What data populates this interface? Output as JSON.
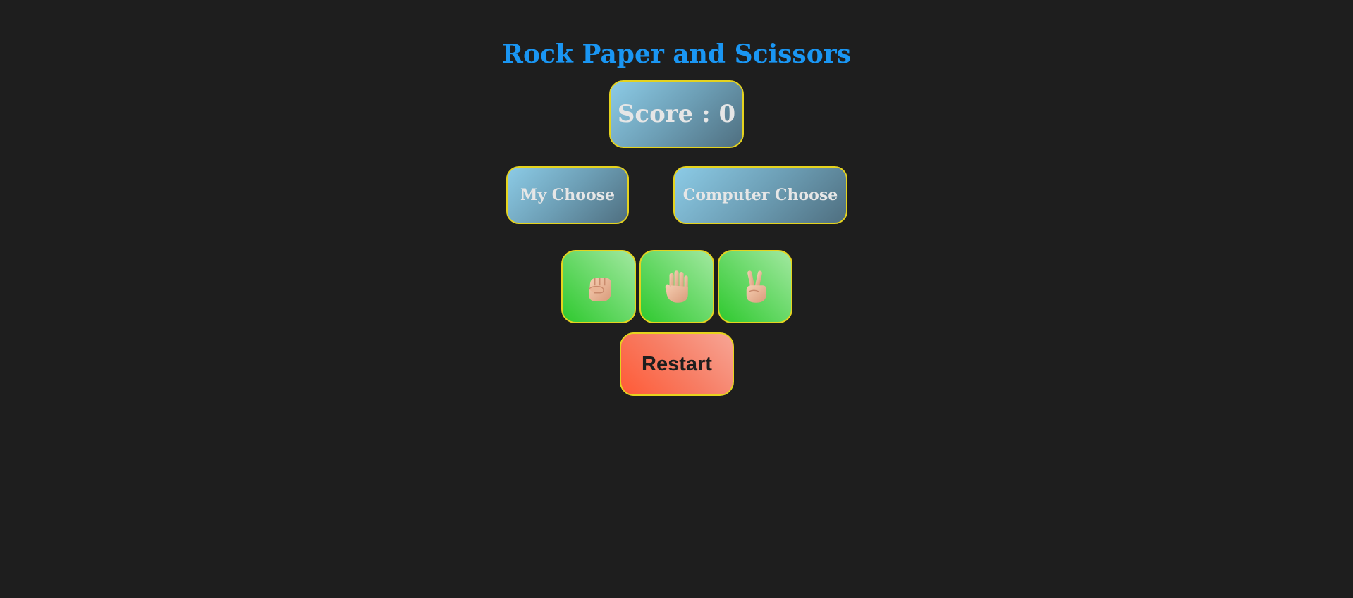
{
  "title": "Rock Paper and Scissors",
  "score": {
    "label": "Score : 0"
  },
  "choices": {
    "mine": "My Choose",
    "computer": "Computer Choose"
  },
  "moves": [
    {
      "id": "rock",
      "icon": "fist-icon"
    },
    {
      "id": "paper",
      "icon": "raised-hand-icon"
    },
    {
      "id": "scissors",
      "icon": "victory-hand-icon"
    }
  ],
  "restart_label": "Restart",
  "colors": {
    "background": "#1e1e1e",
    "title": "#1a96f3",
    "border": "#e5d31e",
    "info_box": "#6d9fb6",
    "move_button": "#3fcf3f",
    "restart_button": "#ff6a4a"
  }
}
